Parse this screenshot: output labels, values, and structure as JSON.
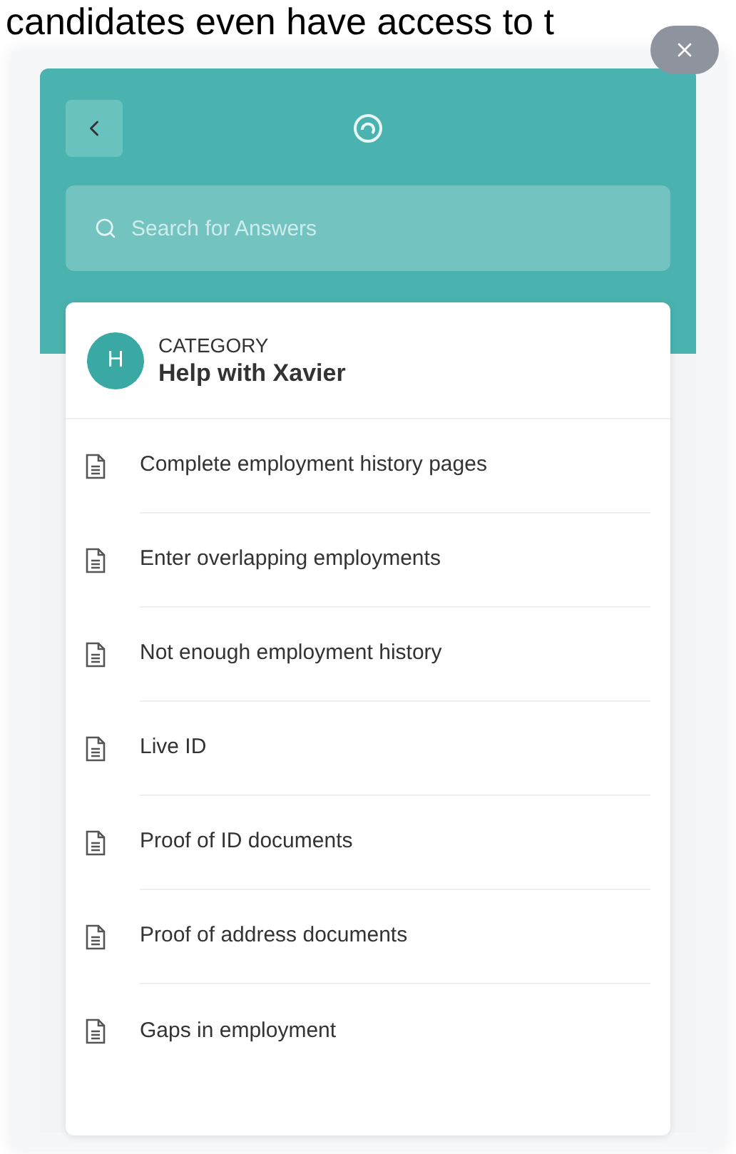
{
  "background_text": "candidates even have access to t",
  "search": {
    "placeholder": "Search for Answers"
  },
  "category": {
    "avatar": "H",
    "label": "CATEGORY",
    "title": "Help with Xavier"
  },
  "articles": [
    {
      "title": "Complete employment history pages"
    },
    {
      "title": "Enter overlapping employments"
    },
    {
      "title": "Not enough employment history"
    },
    {
      "title": "Live ID"
    },
    {
      "title": "Proof of ID documents"
    },
    {
      "title": "Proof of address documents"
    },
    {
      "title": "Gaps in employment"
    }
  ]
}
